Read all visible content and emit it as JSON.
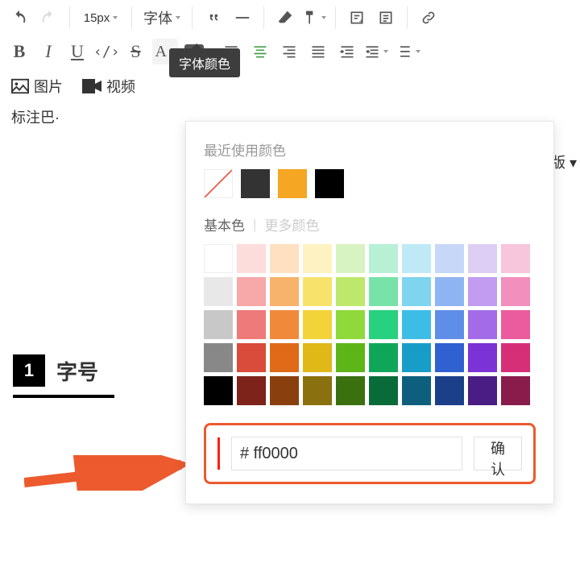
{
  "toolbar": {
    "font_size": "15px",
    "font_family": "字体"
  },
  "format_row": {
    "bold": "B",
    "italic": "I",
    "underline": "U",
    "code": "‹/›",
    "strike": "S",
    "font_color_letter": "A",
    "highlight_badge": "ab"
  },
  "tooltip_font_color": "字体颜色",
  "media": {
    "image": "图片",
    "video": "视频",
    "truncated_right": "版 ▾"
  },
  "body_text": "标注巴·",
  "heading": {
    "num": "1",
    "label": "字号"
  },
  "color_panel": {
    "recent_title": "最近使用颜色",
    "basic_title": "基本色",
    "more_title": "更多颜色",
    "recent": [
      "none",
      "#333333",
      "#f5a623",
      "#000000"
    ],
    "grid": [
      [
        "#ffffff",
        "#fddcdc",
        "#ffe1c2",
        "#fff2c2",
        "#d8f3c2",
        "#b8f0d6",
        "#bfeaf5",
        "#c6d7f7",
        "#dccef5",
        "#f7c5dc"
      ],
      [
        "#e8e8e8",
        "#f7a8a8",
        "#f7b26b",
        "#f7e36b",
        "#bde86b",
        "#78e2a8",
        "#7fd4ee",
        "#8fb4f2",
        "#c19cf0",
        "#f28fbd"
      ],
      [
        "#c8c8c8",
        "#ef7a7a",
        "#f08a3a",
        "#f2d43a",
        "#8fd93a",
        "#28d17f",
        "#3dbde6",
        "#5f8ee8",
        "#a46be8",
        "#ea5c9d"
      ],
      [
        "#888888",
        "#d94b3a",
        "#e06a18",
        "#e0b818",
        "#5db518",
        "#10a65a",
        "#189dc9",
        "#2f61d1",
        "#7b33d6",
        "#d62f78"
      ],
      [
        "#000000",
        "#7d231a",
        "#8a3f0e",
        "#8a700e",
        "#3a700e",
        "#0a6b3a",
        "#0e5f7d",
        "#1c3f8a",
        "#4a1d85",
        "#8a1c4c"
      ]
    ],
    "hex_input": "# ff0000",
    "confirm": "确认",
    "preview_color": "#ff1d0d"
  }
}
